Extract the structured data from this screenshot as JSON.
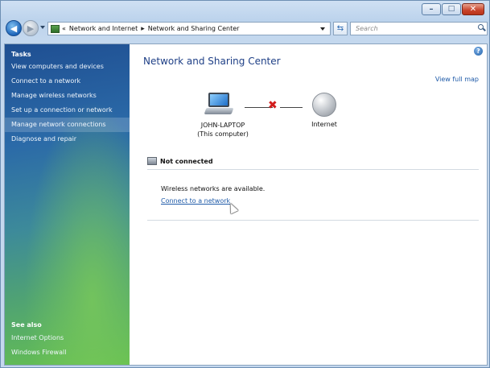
{
  "titlebar": {
    "minimize": "–",
    "maximize": "□",
    "close": "✕"
  },
  "nav": {
    "breadcrumb": {
      "prefix": "«",
      "part1": "Network and Internet",
      "separator": "▸",
      "part2": "Network and Sharing Center"
    },
    "search_placeholder": "Search"
  },
  "sidebar": {
    "tasks_heading": "Tasks",
    "tasks": [
      "View computers and devices",
      "Connect to a network",
      "Manage wireless networks",
      "Set up a connection or network",
      "Manage network connections",
      "Diagnose and repair"
    ],
    "see_also_heading": "See also",
    "see_also": [
      "Internet Options",
      "Windows Firewall"
    ]
  },
  "main": {
    "title": "Network and Sharing Center",
    "view_full_map": "View full map",
    "computer_name": "JOHN-LAPTOP",
    "computer_sub": "(This computer)",
    "internet_label": "Internet",
    "status": "Not connected",
    "wireless_msg": "Wireless networks are available.",
    "connect_link": "Connect to a network",
    "help_glyph": "?"
  },
  "colors": {
    "link": "#1e5aa8",
    "title": "#1e3f86",
    "error_x": "#d21c1c"
  },
  "icons": [
    "back-arrow-icon",
    "forward-arrow-icon",
    "network-folder-icon",
    "refresh-icon",
    "search-icon",
    "help-icon",
    "computer-icon",
    "globe-icon",
    "disconnected-x-icon",
    "network-status-icon",
    "mouse-cursor-icon"
  ]
}
